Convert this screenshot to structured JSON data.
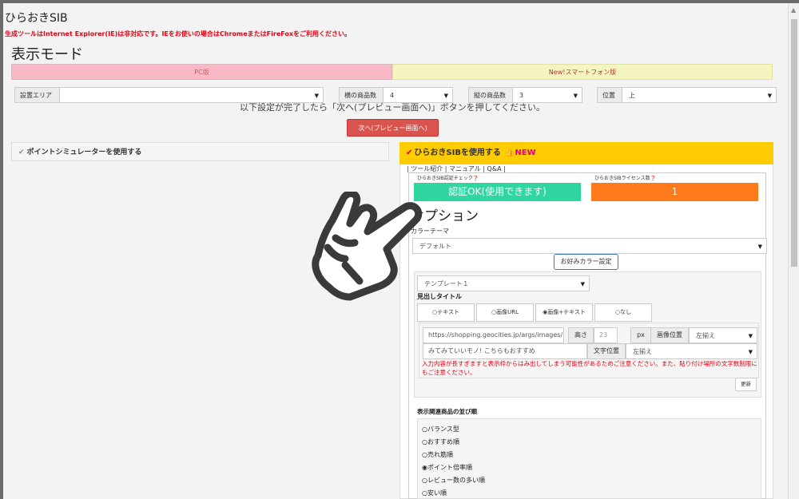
{
  "app": {
    "title": "ひらおきSIB",
    "warning": "生成ツールはInternet Explorer(IE)は非対応です。IEをお使いの場合はChromeまたはFireFoxをご利用ください。"
  },
  "mode": {
    "heading": "表示モード",
    "tabs": [
      {
        "label": "PC版",
        "selected": true
      },
      {
        "label": "New!スマートフォン版",
        "selected": false
      }
    ]
  },
  "settings": {
    "area_label": "設置エリア",
    "area_value": "",
    "h_count_label": "横の商品数",
    "h_count_value": "4",
    "v_count_label": "縦の商品数",
    "v_count_value": "3",
    "position_label": "位置",
    "position_value": "上"
  },
  "instruction": "以下設定が完了したら「次へ(プレビュー画面へ)」ボタンを押してください。",
  "next_button": "次へ(プレビュー画面へ)",
  "left_panel": {
    "label": "ポイントシミュレーターを使用する"
  },
  "sib": {
    "header": "ひらおきSIBを使用する",
    "new_badge": "👍NEW",
    "links": "| ツール紹介 | マニュアル | Q&A |",
    "auth_label": "ひらおきSIB認証チェック❓",
    "auth_value": "認証OK(使用できます)",
    "license_label": "ひらおきSIBライセンス数❓",
    "license_value": "1"
  },
  "options": {
    "title": "オプション",
    "color_theme_label": "カラーテーマ",
    "color_theme_value": "デフォルト",
    "custom_color_button": "お好みカラー設定",
    "template_value": "テンプレート１",
    "heading_title_label": "見出しタイトル",
    "heading_types": [
      {
        "label": "テキスト",
        "selected": false
      },
      {
        "label": "画像URL",
        "selected": false
      },
      {
        "label": "画像+テキスト",
        "selected": true
      },
      {
        "label": "なし",
        "selected": false
      }
    ],
    "image_url_value": "https://shopping.geocities.jp/args/images/160",
    "height_label": "高さ",
    "height_value": "23",
    "px_label": "px",
    "image_pos_label": "画像位置",
    "image_pos_value": "左揃え",
    "title_text_value": "みてみていいモノ! こちらもおすすめ",
    "text_pos_label": "文字位置",
    "text_pos_value": "左揃え",
    "note": "入力内容が長すぎますと表示枠からはみ出してしまう可能性があるためご注意ください。また、貼り付け場所の文字数制限にもご注意ください。",
    "update_button": "更新",
    "order_label": "表示関連商品の並び順",
    "order_items": [
      {
        "label": "バランス型",
        "selected": false
      },
      {
        "label": "おすすめ順",
        "selected": false
      },
      {
        "label": "売れ筋順",
        "selected": false
      },
      {
        "label": "ポイント倍率順",
        "selected": true
      },
      {
        "label": "レビュー数の多い順",
        "selected": false
      },
      {
        "label": "安い順",
        "selected": false
      }
    ]
  },
  "colors": {
    "pc_tab": "#f9b8c6",
    "sp_tab": "#f5f5c0",
    "next_button": "#d9534f",
    "sib_header": "#ffcc00",
    "auth_ok": "#2fd6a0",
    "license": "#ff7a1a",
    "warning_text": "#e60012"
  },
  "overlay_icon": "pointing-hand-icon"
}
